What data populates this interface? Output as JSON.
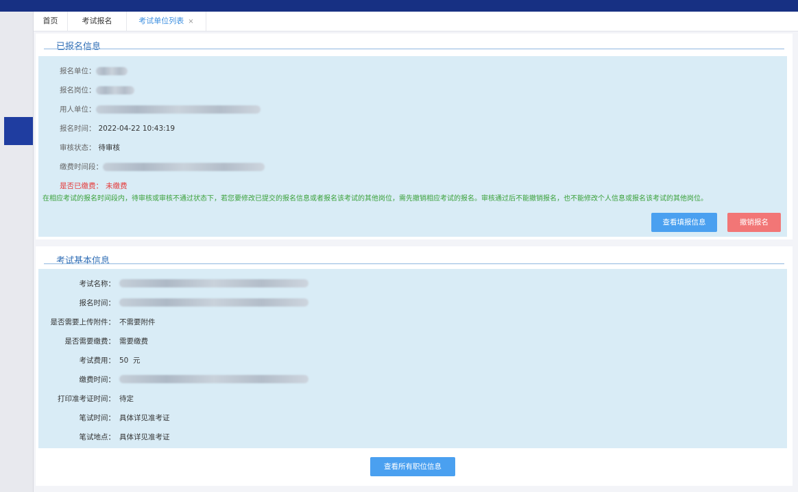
{
  "tabs": [
    {
      "label": "首页"
    },
    {
      "label": "考试报名"
    },
    {
      "label": "考试单位列表",
      "close": "×"
    }
  ],
  "registered": {
    "title": "已报名信息",
    "unit_label": "报名单位：",
    "post_label": "报名岗位：",
    "employer_label": "用人单位：",
    "time_label": "报名时间：",
    "time_value": "2022-04-22 10:43:19",
    "review_label": "审核状态：",
    "review_value": "待审核",
    "pay_period_label": "缴费时间段：",
    "paid_label": "是否已缴费：",
    "paid_value": "未缴费",
    "notice": "在相应考试的报名时间段内，待审核或审核不通过状态下，若您要修改已提交的报名信息或者报名该考试的其他岗位，需先撤销相应考试的报名。审核通过后不能撤销报名，也不能修改个人信息或报名该考试的其他岗位。",
    "view_button": "查看填报信息",
    "cancel_button": "撤销报名"
  },
  "exam": {
    "title": "考试基本信息",
    "name_label": "考试名称：",
    "reg_time_label": "报名时间：",
    "attach_label": "是否需要上传附件：",
    "attach_value": "不需要附件",
    "fee_needed_label": "是否需要缴费：",
    "fee_needed_value": "需要缴费",
    "fee_label": "考试费用：",
    "fee_value": "50  元",
    "pay_time_label": "缴费时间：",
    "print_label": "打印准考证时间：",
    "print_value": "待定",
    "written_time_label": "笔试时间：",
    "written_time_value": "具体详见准考证",
    "written_place_label": "笔试地点：",
    "written_place_value": "具体详见准考证",
    "all_positions_button": "查看所有职位信息"
  },
  "colors": {
    "topbar": "#173083",
    "accent": "#2f6db5",
    "button_blue": "#4aa0f0",
    "button_red": "#f27676",
    "info_bg": "#d9ecf6",
    "notice_green": "#3aa13a",
    "status_red": "#e53a3a"
  }
}
